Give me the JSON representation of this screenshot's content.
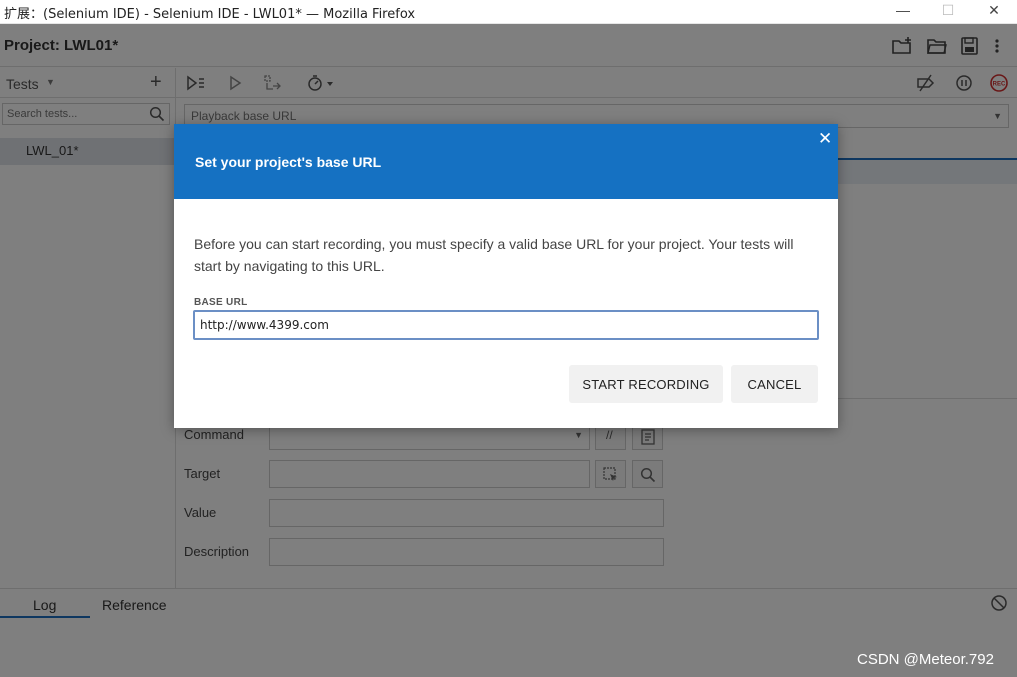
{
  "window": {
    "title": "扩展：(Selenium IDE) - Selenium IDE - LWL01* — Mozilla Firefox",
    "minimize": "—",
    "maximize": "☐",
    "close": "✕"
  },
  "header": {
    "project_title": "Project:  LWL01*",
    "icons": [
      "new-project-icon",
      "open-folder-icon",
      "save-icon",
      "more-vert-icon"
    ]
  },
  "sidebar": {
    "tests_label": "Tests",
    "add_label": "+",
    "search_placeholder": "Search tests...",
    "items": [
      {
        "label": "LWL_01*"
      }
    ]
  },
  "toolbar": {
    "icons": [
      "run-all-icon",
      "run-icon",
      "step-icon",
      "speed-icon",
      "disable-breakpoints-icon",
      "pause-icon",
      "record-icon"
    ],
    "record_label": "REC"
  },
  "url_bar": {
    "placeholder": "Playback base URL"
  },
  "editor": {
    "command_label": "Command",
    "target_label": "Target",
    "value_label": "Value",
    "description_label": "Description",
    "comment_btn": "//"
  },
  "bottom": {
    "tabs": [
      "Log",
      "Reference"
    ]
  },
  "dialog": {
    "title": "Set your project's base URL",
    "close": "✕",
    "description": "Before you can start recording, you must specify a valid base URL for your project. Your tests will start by navigating to this URL.",
    "field_label": "BASE URL",
    "field_value": "http://www.4399.com",
    "start_button": "START RECORDING",
    "cancel_button": "CANCEL"
  },
  "watermark": "CSDN @Meteor.792",
  "colors": {
    "accent": "#1571c2",
    "record": "#d32f2f"
  }
}
